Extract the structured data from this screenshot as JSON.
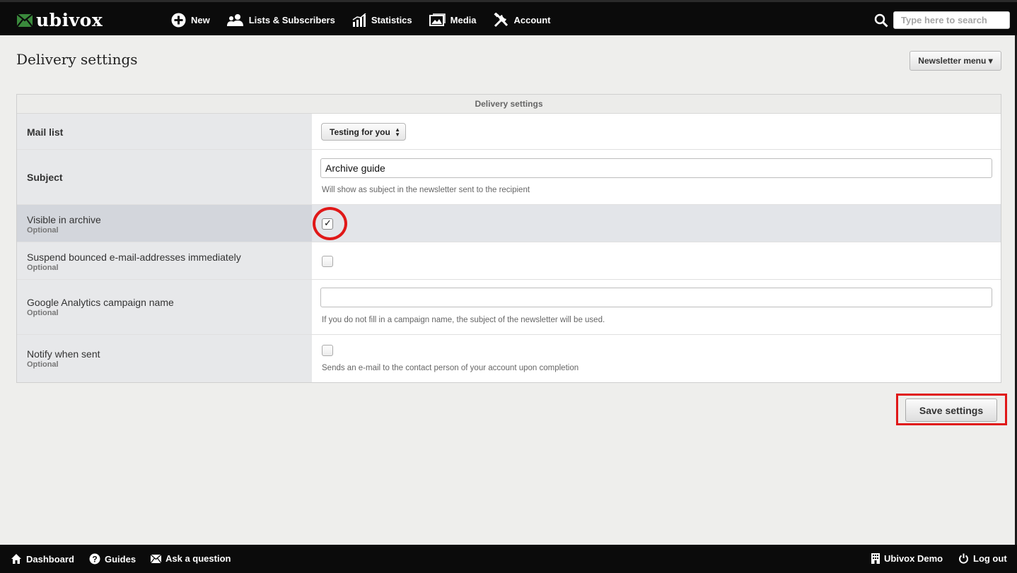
{
  "app": {
    "logo_text": "ubivox"
  },
  "nav": {
    "items": [
      {
        "label": "New",
        "icon": "plus-circle-icon"
      },
      {
        "label": "Lists & Subscribers",
        "icon": "users-icon"
      },
      {
        "label": "Statistics",
        "icon": "bar-chart-icon"
      },
      {
        "label": "Media",
        "icon": "image-icon"
      },
      {
        "label": "Account",
        "icon": "tools-icon"
      }
    ]
  },
  "search": {
    "placeholder": "Type here to search",
    "value": ""
  },
  "page": {
    "title": "Delivery settings",
    "menu_button": "Newsletter menu ▾"
  },
  "panel": {
    "header": "Delivery settings",
    "rows": {
      "mail_list": {
        "label": "Mail list",
        "selected": "Testing for you"
      },
      "subject": {
        "label": "Subject",
        "value": "Archive guide",
        "hint": "Will show as subject in the newsletter sent to the recipient"
      },
      "visible_archive": {
        "label": "Visible in archive",
        "optional": "Optional",
        "checked": true
      },
      "suspend_bounced": {
        "label": "Suspend bounced e-mail-addresses immediately",
        "optional": "Optional",
        "checked": false
      },
      "ga_campaign": {
        "label": "Google Analytics campaign name",
        "optional": "Optional",
        "value": "",
        "hint": "If you do not fill in a campaign name, the subject of the newsletter will be used."
      },
      "notify_sent": {
        "label": "Notify when sent",
        "optional": "Optional",
        "checked": false,
        "hint": "Sends an e-mail to the contact person of your account upon completion"
      }
    }
  },
  "actions": {
    "save": "Save settings"
  },
  "footer": {
    "left": [
      {
        "label": "Dashboard",
        "icon": "home-icon"
      },
      {
        "label": "Guides",
        "icon": "help-icon"
      },
      {
        "label": "Ask a question",
        "icon": "mail-icon"
      }
    ],
    "right": [
      {
        "label": "Ubivox Demo",
        "icon": "building-icon"
      },
      {
        "label": "Log out",
        "icon": "power-icon"
      }
    ]
  },
  "colors": {
    "highlight": "#e01818",
    "topbar": "#0b0b0b"
  }
}
